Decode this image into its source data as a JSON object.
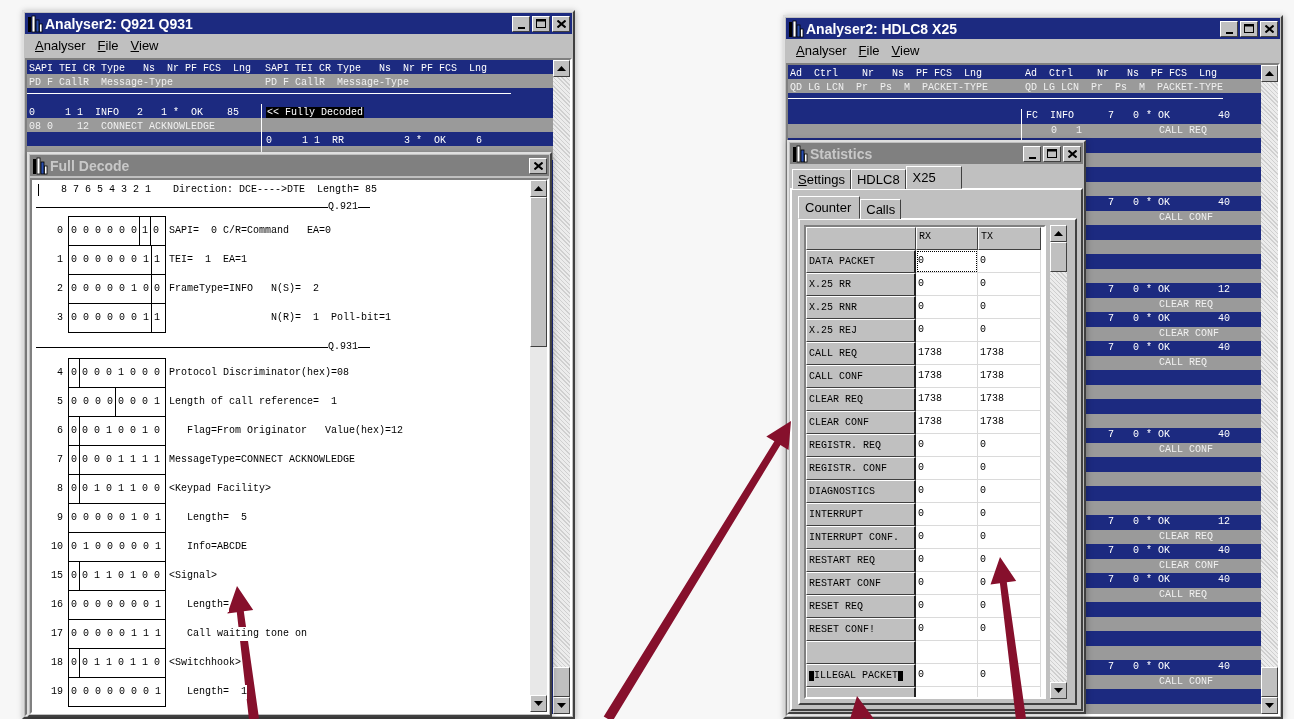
{
  "left_window": {
    "title": "Analyser2: Q921 Q931",
    "active": true,
    "menu": [
      "Analyser",
      "File",
      "View"
    ],
    "list": {
      "header_line1": [
        "SAPI TEI CR Type   Ns  Nr PF FCS  Lng",
        "SAPI TEI CR Type   Ns  Nr PF FCS  Lng"
      ],
      "header_line2": [
        "PD F CallR  Message-Type",
        "PD F CallR  Message-Type"
      ],
      "entries": [
        {
          "left_line1": "0     1 1  INFO   2   1 *  OK    85",
          "left_line2": "08 0    12  CONNECT ACKNOWLEDGE",
          "right_line1": "<< Fully Decoded",
          "right_highlighted": true
        },
        {
          "right_line1": "0     1 1  RR          3 *  OK     6",
          "right_highlighted": false
        }
      ]
    }
  },
  "full_decode": {
    "title": "Full Decode",
    "active": false,
    "bit_numbers": "8 7 6 5 4 3 2 1",
    "direction": "Direction: DCE---->DTE  Length= 85",
    "sections": [
      {
        "title": "Q.921",
        "rows": [
          {
            "index": "0",
            "bits": [
              "0 0 0 0 0 0",
              "1",
              "0"
            ],
            "text": "SAPI=  0 C/R=Command   EA=0"
          },
          {
            "index": "1",
            "bits": [
              "0 0 0 0 0 0 1",
              "1"
            ],
            "text": "TEI=  1  EA=1"
          },
          {
            "index": "2",
            "bits": [
              "0 0 0 0 0 1 0",
              "0"
            ],
            "text": "FrameType=INFO   N(S)=  2"
          },
          {
            "index": "3",
            "bits": [
              "0 0 0 0 0 0 1",
              "1"
            ],
            "text": "                 N(R)=  1  Poll-bit=1"
          }
        ]
      },
      {
        "title": "Q.931",
        "rows": [
          {
            "index": "4",
            "bits": [
              "0",
              "0 0 0 1 0 0 0"
            ],
            "text": "Protocol Discriminator(hex)=08"
          },
          {
            "index": "5",
            "bits": [
              "0 0 0 0",
              "0 0 0 1"
            ],
            "text": "Length of call reference=  1"
          },
          {
            "index": "6",
            "bits": [
              "0",
              "0 0 1 0 0 1 0"
            ],
            "text": "   Flag=From Originator   Value(hex)=12"
          },
          {
            "index": "7",
            "bits": [
              "0",
              "0 0 0 1 1 1 1"
            ],
            "text": "MessageType=CONNECT ACKNOWLEDGE"
          },
          {
            "index": "8",
            "bits": [
              "0",
              "0 1 0 1 1 0 0"
            ],
            "text": "<Keypad Facility>"
          },
          {
            "index": "9",
            "bits": [
              "0 0 0 0 0 1 0 1"
            ],
            "text": "   Length=  5"
          },
          {
            "index": "10",
            "bits": [
              "0 1 0 0 0 0 0 1"
            ],
            "text": "   Info=ABCDE"
          },
          {
            "index": "15",
            "bits": [
              "0",
              "0 1 1 0 1 0 0"
            ],
            "text": "<Signal>"
          },
          {
            "index": "16",
            "bits": [
              "0 0 0 0 0 0 0 1"
            ],
            "text": "   Length="
          },
          {
            "index": "17",
            "bits": [
              "0 0 0 0 0 1 1 1"
            ],
            "text": "   Call waiting tone on"
          },
          {
            "index": "18",
            "bits": [
              "0",
              "0 1 1 0 1 1 0"
            ],
            "text": "<Switchhook>"
          },
          {
            "index": "19",
            "bits": [
              "0 0 0 0 0 0 0 1"
            ],
            "text": "   Length=  1"
          }
        ]
      }
    ]
  },
  "right_window": {
    "title": "Analyser2: HDLC8 X25",
    "active": true,
    "menu": [
      "Analyser",
      "File",
      "View"
    ],
    "list": {
      "header_line1": [
        "Ad  Ctrl    Nr   Ns  PF FCS  Lng",
        "Ad  Ctrl    Nr   Ns  PF FCS  Lng"
      ],
      "header_line2": [
        "QD LG LCN  Pr  Ps  M  PACKET-TYPE",
        "QD LG LCN  Pr  Ps  M  PACKET-TYPE"
      ],
      "entries": [
        {
          "kind": "packet",
          "ad": "FC",
          "ctrl": "INFO",
          "nr": "7",
          "ns": "0",
          "pf_fcs": "* OK",
          "lng": "40",
          "lg": "0",
          "lcn": "1",
          "packet_type": "CALL REQ"
        },
        {
          "kind": "blank"
        },
        {
          "kind": "blank"
        },
        {
          "kind": "packet",
          "nr": "7",
          "ns": "0",
          "pf_fcs": "* OK",
          "lng": "40",
          "packet_type": "CALL CONF"
        },
        {
          "kind": "blank"
        },
        {
          "kind": "blank"
        },
        {
          "kind": "packet",
          "nr": "7",
          "ns": "0",
          "pf_fcs": "* OK",
          "lng": "12",
          "packet_type": "CLEAR REQ"
        },
        {
          "kind": "packet",
          "nr": "7",
          "ns": "0",
          "pf_fcs": "* OK",
          "lng": "40",
          "packet_type": "CLEAR CONF"
        },
        {
          "kind": "packet",
          "nr": "7",
          "ns": "0",
          "pf_fcs": "* OK",
          "lng": "40",
          "packet_type": "CALL REQ"
        },
        {
          "kind": "blank"
        },
        {
          "kind": "blank"
        },
        {
          "kind": "packet",
          "nr": "7",
          "ns": "0",
          "pf_fcs": "* OK",
          "lng": "40",
          "packet_type": "CALL CONF"
        },
        {
          "kind": "blank"
        },
        {
          "kind": "blank"
        },
        {
          "kind": "packet",
          "nr": "7",
          "ns": "0",
          "pf_fcs": "* OK",
          "lng": "12",
          "packet_type": "CLEAR REQ"
        },
        {
          "kind": "packet",
          "nr": "7",
          "ns": "0",
          "pf_fcs": "* OK",
          "lng": "40",
          "packet_type": "CLEAR CONF"
        },
        {
          "kind": "packet",
          "nr": "7",
          "ns": "0",
          "pf_fcs": "* OK",
          "lng": "40",
          "packet_type": "CALL REQ"
        },
        {
          "kind": "blank"
        },
        {
          "kind": "blank"
        },
        {
          "kind": "packet",
          "nr": "7",
          "ns": "0",
          "pf_fcs": "* OK",
          "lng": "40",
          "packet_type": "CALL CONF"
        },
        {
          "kind": "blank"
        }
      ]
    }
  },
  "statistics": {
    "title": "Statistics",
    "active": false,
    "tabs": [
      {
        "label": "Settings",
        "selected": false,
        "accel": true
      },
      {
        "label": "HDLC8",
        "selected": false,
        "accel": false
      },
      {
        "label": "X25",
        "selected": true,
        "accel": false
      }
    ],
    "subtabs": [
      {
        "label": "Counter",
        "selected": true
      },
      {
        "label": "Calls",
        "selected": false
      }
    ],
    "columns": [
      "RX",
      "TX"
    ],
    "rows": [
      {
        "label": "DATA PACKET",
        "rx": "0",
        "tx": "0",
        "rx_focused": true,
        "marked": false
      },
      {
        "label": "X.25 RR",
        "rx": "0",
        "tx": "0",
        "rx_focused": false,
        "marked": false
      },
      {
        "label": "X.25 RNR",
        "rx": "0",
        "tx": "0",
        "rx_focused": false,
        "marked": false
      },
      {
        "label": "X.25 REJ",
        "rx": "0",
        "tx": "0",
        "rx_focused": false,
        "marked": false
      },
      {
        "label": "CALL REQ",
        "rx": "1738",
        "tx": "1738",
        "rx_focused": false,
        "marked": false
      },
      {
        "label": "CALL CONF",
        "rx": "1738",
        "tx": "1738",
        "rx_focused": false,
        "marked": false
      },
      {
        "label": "CLEAR REQ",
        "rx": "1738",
        "tx": "1738",
        "rx_focused": false,
        "marked": false
      },
      {
        "label": "CLEAR CONF",
        "rx": "1738",
        "tx": "1738",
        "rx_focused": false,
        "marked": false
      },
      {
        "label": "REGISTR. REQ",
        "rx": "0",
        "tx": "0",
        "rx_focused": false,
        "marked": false
      },
      {
        "label": "REGISTR. CONF",
        "rx": "0",
        "tx": "0",
        "rx_focused": false,
        "marked": false
      },
      {
        "label": "DIAGNOSTICS",
        "rx": "0",
        "tx": "0",
        "rx_focused": false,
        "marked": false
      },
      {
        "label": "INTERRUPT",
        "rx": "0",
        "tx": "0",
        "rx_focused": false,
        "marked": false
      },
      {
        "label": "INTERRUPT CONF.",
        "rx": "0",
        "tx": "0",
        "rx_focused": false,
        "marked": false
      },
      {
        "label": "RESTART REQ",
        "rx": "0",
        "tx": "0",
        "rx_focused": false,
        "marked": false
      },
      {
        "label": "RESTART CONF",
        "rx": "0",
        "tx": "0",
        "rx_focused": false,
        "marked": false
      },
      {
        "label": "RESET REQ",
        "rx": "0",
        "tx": "0",
        "rx_focused": false,
        "marked": false
      },
      {
        "label": "RESET CONF!",
        "rx": "0",
        "tx": "0",
        "rx_focused": false,
        "marked": false
      },
      {
        "rx_focused": false,
        "marked": false
      },
      {
        "label": "ILLEGAL PACKET",
        "rx": "0",
        "tx": "0",
        "rx_focused": false,
        "marked": true
      },
      {
        "rx_focused": false,
        "marked": false
      }
    ]
  }
}
